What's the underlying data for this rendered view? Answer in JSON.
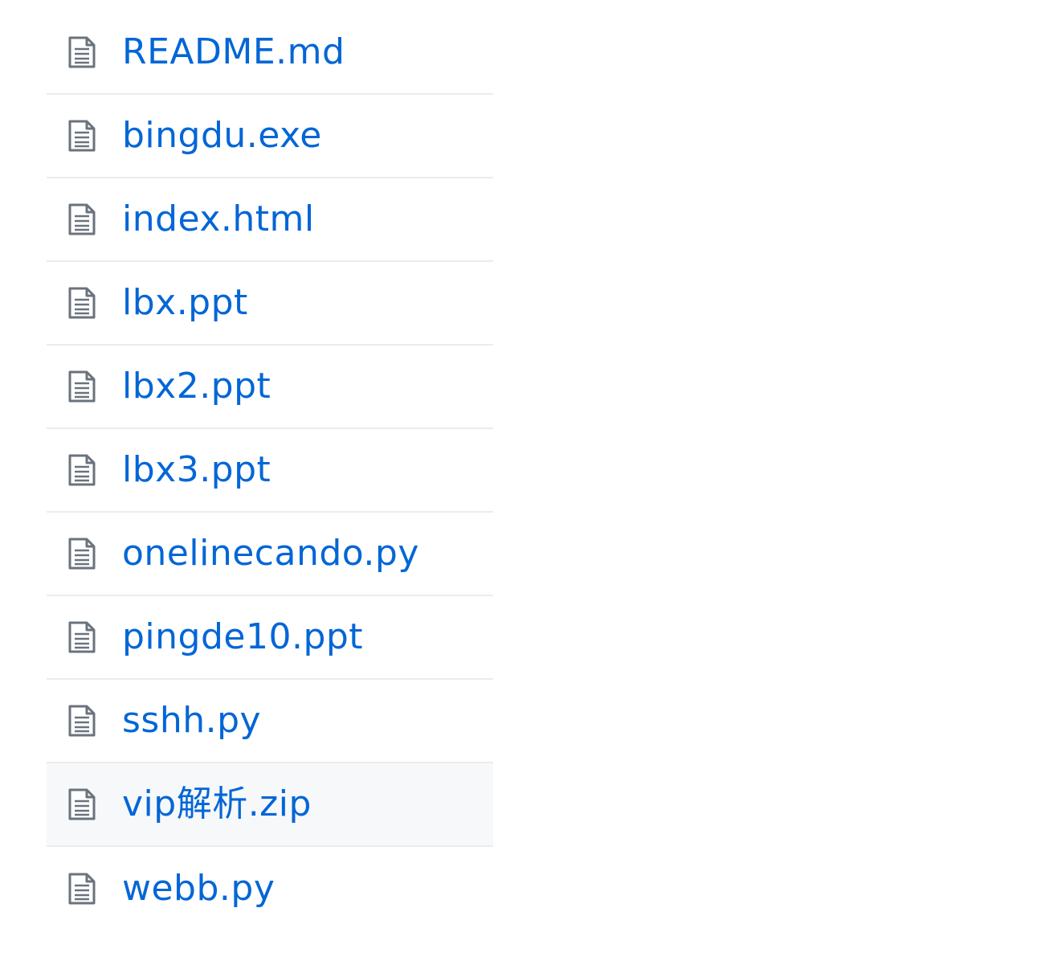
{
  "files": [
    {
      "name": "README.md",
      "icon": "file-text-icon"
    },
    {
      "name": "bingdu.exe",
      "icon": "file-text-icon"
    },
    {
      "name": "index.html",
      "icon": "file-text-icon"
    },
    {
      "name": "lbx.ppt",
      "icon": "file-text-icon"
    },
    {
      "name": "lbx2.ppt",
      "icon": "file-text-icon"
    },
    {
      "name": "lbx3.ppt",
      "icon": "file-text-icon"
    },
    {
      "name": "onelinecando.py",
      "icon": "file-text-icon"
    },
    {
      "name": "pingde10.ppt",
      "icon": "file-text-icon"
    },
    {
      "name": "sshh.py",
      "icon": "file-text-icon"
    },
    {
      "name": "vip解析.zip",
      "icon": "file-text-icon"
    },
    {
      "name": "webb.py",
      "icon": "file-text-icon"
    }
  ],
  "colors": {
    "link": "#0366d6",
    "icon": "#6a737d",
    "divider": "#eaecef",
    "hover_row": "#f6f8fa"
  }
}
